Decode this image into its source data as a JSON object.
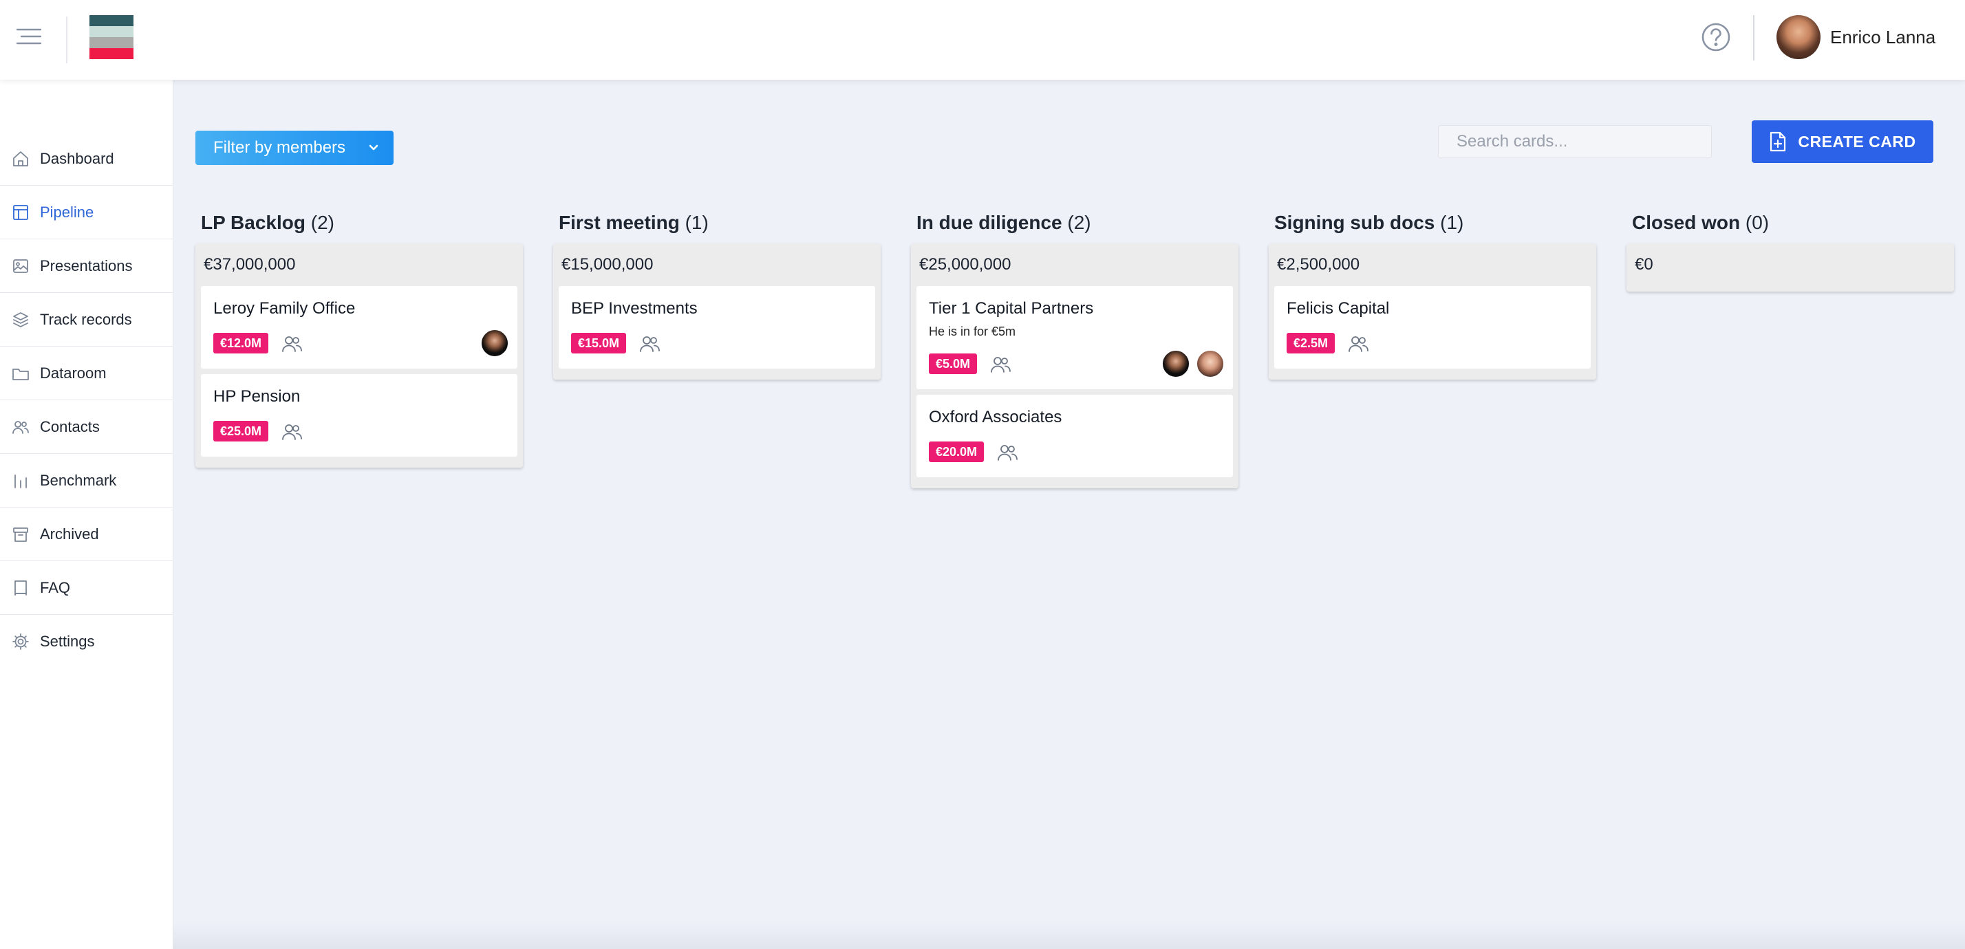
{
  "header": {
    "user_name": "Enrico Lanna",
    "logo_colors": [
      "#2f5c63",
      "#c9ddd9",
      "#ababa9",
      "#ef1a45"
    ]
  },
  "sidebar": {
    "items": [
      {
        "label": "Dashboard",
        "icon": "home-icon",
        "active": false
      },
      {
        "label": "Pipeline",
        "icon": "pipeline-icon",
        "active": true
      },
      {
        "label": "Presentations",
        "icon": "image-icon",
        "active": false
      },
      {
        "label": "Track records",
        "icon": "layers-icon",
        "active": false
      },
      {
        "label": "Dataroom",
        "icon": "folder-icon",
        "active": false
      },
      {
        "label": "Contacts",
        "icon": "users-icon",
        "active": false
      },
      {
        "label": "Benchmark",
        "icon": "bar-chart-icon",
        "active": false
      },
      {
        "label": "Archived",
        "icon": "archive-icon",
        "active": false
      },
      {
        "label": "FAQ",
        "icon": "book-icon",
        "active": false
      },
      {
        "label": "Settings",
        "icon": "gear-icon",
        "active": false
      }
    ]
  },
  "toolbar": {
    "filter_label": "Filter by members",
    "search_placeholder": "Search cards...",
    "create_label": "CREATE CARD"
  },
  "columns": [
    {
      "title": "LP Backlog",
      "count": "(2)",
      "total": "€37,000,000",
      "cards": [
        {
          "title": "Leroy Family Office",
          "note": "",
          "amount": "€12.0M",
          "avatars": [
            "dark"
          ]
        },
        {
          "title": "HP Pension",
          "note": "",
          "amount": "€25.0M",
          "avatars": []
        }
      ]
    },
    {
      "title": "First meeting",
      "count": "(1)",
      "total": "€15,000,000",
      "cards": [
        {
          "title": "BEP Investments",
          "note": "",
          "amount": "€15.0M",
          "avatars": []
        }
      ]
    },
    {
      "title": "In due diligence",
      "count": "(2)",
      "total": "€25,000,000",
      "cards": [
        {
          "title": "Tier 1 Capital Partners",
          "note": "He is in for €5m",
          "amount": "€5.0M",
          "avatars": [
            "dark",
            "light"
          ]
        },
        {
          "title": "Oxford Associates",
          "note": "",
          "amount": "€20.0M",
          "avatars": []
        }
      ]
    },
    {
      "title": "Signing sub docs",
      "count": "(1)",
      "total": "€2,500,000",
      "cards": [
        {
          "title": "Felicis Capital",
          "note": "",
          "amount": "€2.5M",
          "avatars": []
        }
      ]
    },
    {
      "title": "Closed won",
      "count": "(0)",
      "total": "€0",
      "cards": []
    }
  ],
  "colors": {
    "accent": "#2b62e8",
    "active_nav": "#2f67d8",
    "tag": "#ec1c73",
    "filter_start": "#46b0f3",
    "filter_end": "#1b8ef0"
  }
}
